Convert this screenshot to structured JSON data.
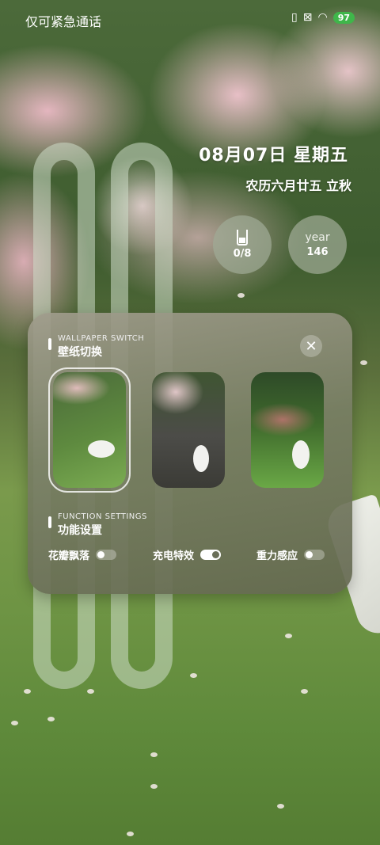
{
  "status_bar": {
    "carrier_text": "仅可紧急通话",
    "battery": "97"
  },
  "clock": {
    "date": "08月07日 星期五",
    "lunar": "农历六月廿五 立秋"
  },
  "widgets": {
    "water": {
      "icon": "cup-icon",
      "value": "0/8"
    },
    "year": {
      "label": "year",
      "value": "146"
    }
  },
  "panel": {
    "wallpaper_section": {
      "en": "WALLPAPER SWITCH",
      "zh": "壁纸切换"
    },
    "wallpapers": [
      {
        "name": "wallpaper-1",
        "selected": true
      },
      {
        "name": "wallpaper-2",
        "selected": false
      },
      {
        "name": "wallpaper-3",
        "selected": false
      }
    ],
    "function_section": {
      "en": "FUNCTION SETTINGS",
      "zh": "功能设置"
    },
    "toggles": [
      {
        "label": "花瓣飘落",
        "on": false
      },
      {
        "label": "充电特效",
        "on": true
      },
      {
        "label": "重力感应",
        "on": false
      }
    ],
    "close_symbol": "✕"
  }
}
